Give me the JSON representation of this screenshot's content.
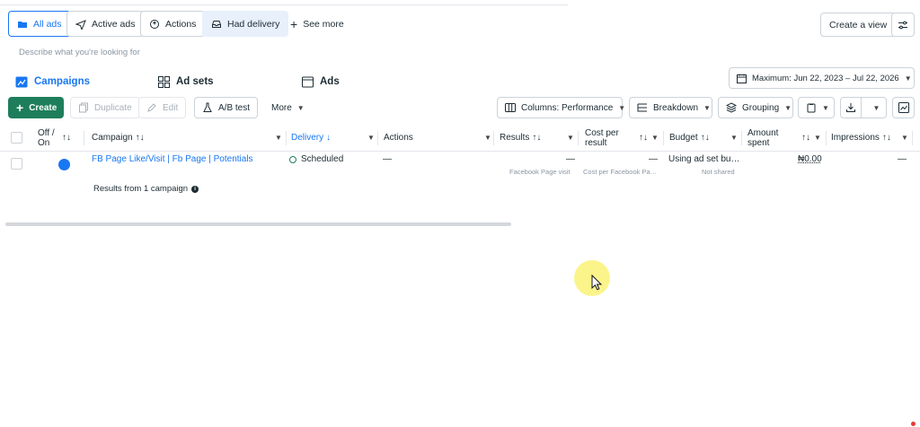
{
  "filters": {
    "all_ads": "All ads",
    "active_ads": "Active ads",
    "actions": "Actions",
    "had_delivery": "Had delivery",
    "see_more": "See more",
    "create_view": "Create a view"
  },
  "search": {
    "placeholder": "Describe what you're looking for"
  },
  "tabs": {
    "campaigns": "Campaigns",
    "ad_sets": "Ad sets",
    "ads": "Ads"
  },
  "date_range": "Maximum: Jun 22, 2023 – Jul 22, 2026",
  "toolbar": {
    "create": "Create",
    "duplicate": "Duplicate",
    "edit": "Edit",
    "ab_test": "A/B test",
    "more": "More",
    "columns": "Columns: Performance",
    "breakdown": "Breakdown",
    "grouping": "Grouping"
  },
  "table": {
    "headers": {
      "off_on_1": "Off /",
      "off_on_2": "On",
      "campaign": "Campaign",
      "delivery": "Delivery",
      "actions": "Actions",
      "results": "Results",
      "cost_per_result_1": "Cost per",
      "cost_per_result_2": "result",
      "budget": "Budget",
      "amount_spent_1": "Amount",
      "amount_spent_2": "spent",
      "impressions": "Impressions"
    },
    "row": {
      "campaign": "FB Page Like/Visit | Fb Page | Potentials",
      "delivery": "Scheduled",
      "actions": "—",
      "results": "—",
      "results_sub": "Facebook Page visit",
      "cost_per_result": "—",
      "cost_per_result_sub": "Cost per Facebook Pa…",
      "budget": "Using ad set bu…",
      "budget_sub": "Not shared",
      "amount_spent": "₦0.00",
      "impressions": "—"
    },
    "footer": "Results from 1 campaign"
  },
  "colors": {
    "accent": "#1877f2",
    "create": "#1e7e5c",
    "toggle": "#1877f2"
  }
}
